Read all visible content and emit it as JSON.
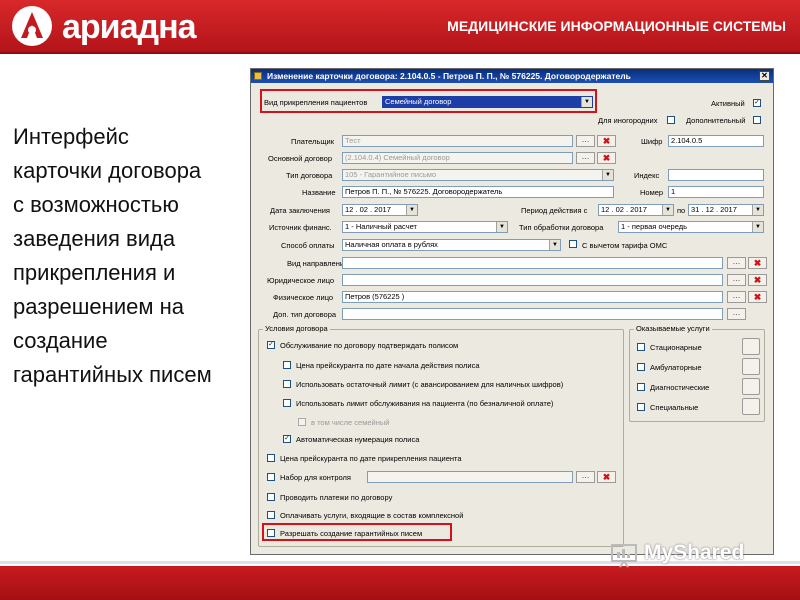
{
  "header": {
    "brand": "ариадна",
    "tagline": "МЕДИЦИНСКИЕ ИНФОРМАЦИОННЫЕ СИСТЕМЫ",
    "bg_color": "#c41a1f"
  },
  "description": {
    "lines": [
      "Интерфейс",
      "карточки договора",
      "с возможностью",
      "заведения вида",
      "прикрепления и",
      "разрешением на",
      "создание",
      "гарантийных писем"
    ]
  },
  "window": {
    "title": "Изменение карточки договора: 2.104.0.5 - Петров П. П., № 576225. Договородержатель",
    "close_label": "✕",
    "attach_type": {
      "label": "Вид прикрепления пациентов",
      "value": "Семейный договор"
    },
    "active": {
      "label": "Активный",
      "checked": true
    },
    "foreigners": {
      "label": "Для иногородних",
      "checked": false
    },
    "additional": {
      "label": "Дополнительный",
      "checked": false
    },
    "payer": {
      "label": "Плательщик",
      "value": "Тест"
    },
    "main_contract": {
      "label": "Основной договор",
      "value": "(2.104.0.4) Семейный договор"
    },
    "cipher": {
      "label": "Шифр",
      "value": "2.104.0.5"
    },
    "contract_type": {
      "label": "Тип договора",
      "value": "105 - Гарантийное письмо"
    },
    "index": {
      "label": "Индекс",
      "value": ""
    },
    "name": {
      "label": "Название",
      "value": "Петров П. П., № 576225. Договородержатель"
    },
    "number": {
      "label": "Номер",
      "value": "1"
    },
    "conclusion_date": {
      "label": "Дата заключения",
      "value": "12 . 02 . 2017"
    },
    "period": {
      "label": "Период действия с",
      "from": "12 . 02 . 2017",
      "to_label": "по",
      "to": "31 . 12 . 2017"
    },
    "finance_source": {
      "label": "Источник финанс.",
      "value": "1 - Наличный расчет"
    },
    "processing_type": {
      "label": "Тип обработки договора",
      "value": "1 - первая очередь"
    },
    "payment_method": {
      "label": "Способ оплаты",
      "value": "Наличная оплата в рублях"
    },
    "oms_excl": {
      "label": "С вычетом тарифа ОМС",
      "checked": false
    },
    "referral_type": {
      "label": "Вид направления",
      "value": ""
    },
    "legal_entity": {
      "label": "Юридическое лицо",
      "value": ""
    },
    "individual": {
      "label": "Физическое лицо",
      "value": "Петров  (576225 )"
    },
    "add_contract_type": {
      "label": "Доп. тип договора",
      "value": ""
    },
    "conditions": {
      "title": "Условия договора",
      "items": [
        {
          "label": "Обслуживание по договору подтверждать полисом",
          "checked": true
        },
        {
          "label": "Цена прейскуранта по дате начала действия полиса",
          "checked": false
        },
        {
          "label": "Использовать остаточный лимит (с авансированием для наличных шифров)",
          "checked": false
        },
        {
          "label": "Использовать лимит обслуживания на пациента (по безналичной оплате)",
          "checked": false
        },
        {
          "label": "в том числе семейный",
          "checked": false
        },
        {
          "label": "Автоматическая нумерация полиса",
          "checked": true
        },
        {
          "label": "Цена прейскуранта по дате прикрепления пациента",
          "checked": false
        },
        {
          "label": "Набор для контроля",
          "checked": false
        },
        {
          "label": "Проводить платежи по договору",
          "checked": false
        },
        {
          "label": "Оплачивать услуги, входящие в состав комплексной",
          "checked": false
        },
        {
          "label": "Разрешать создание гарантийных писем",
          "checked": false
        }
      ]
    },
    "services": {
      "title": "Оказываемые услуги",
      "items": [
        {
          "label": "Стационарные",
          "checked": false
        },
        {
          "label": "Амбулаторные",
          "checked": false
        },
        {
          "label": "Диагностические",
          "checked": false
        },
        {
          "label": "Специальные",
          "checked": false
        }
      ]
    }
  },
  "icons": {
    "browse": "…",
    "clear": "✖",
    "dropdown": "▼",
    "check": "✓"
  },
  "watermark": "MyShared",
  "highlight_color": "#d4121c"
}
